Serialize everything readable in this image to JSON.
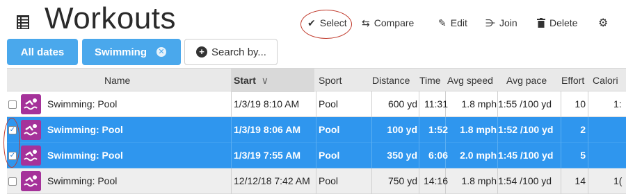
{
  "header": {
    "title": "Workouts",
    "actions": {
      "select": "Select",
      "compare": "Compare",
      "edit": "Edit",
      "join": "Join",
      "delete": "Delete"
    }
  },
  "filters": {
    "all_dates": "All dates",
    "swimming": "Swimming",
    "search_by": "Search by..."
  },
  "table": {
    "headers": {
      "name": "Name",
      "start": "Start",
      "sport": "Sport",
      "distance": "Distance",
      "time": "Time",
      "avg_speed": "Avg speed",
      "avg_pace": "Avg pace",
      "effort": "Effort",
      "calories": "Calori"
    },
    "rows": [
      {
        "name": "Swimming: Pool",
        "start": "1/3/19 8:10 AM",
        "sport": "Pool",
        "distance": "600 yd",
        "time": "11:31",
        "avg_speed": "1.8 mph",
        "avg_pace": "1:55 /100 yd",
        "effort": "10",
        "calories": "1:",
        "checked": false,
        "selected": false
      },
      {
        "name": "Swimming: Pool",
        "start": "1/3/19 8:06 AM",
        "sport": "Pool",
        "distance": "100 yd",
        "time": "1:52",
        "avg_speed": "1.8 mph",
        "avg_pace": "1:52 /100 yd",
        "effort": "2",
        "calories": "",
        "checked": true,
        "selected": true
      },
      {
        "name": "Swimming: Pool",
        "start": "1/3/19 7:55 AM",
        "sport": "Pool",
        "distance": "350 yd",
        "time": "6:06",
        "avg_speed": "2.0 mph",
        "avg_pace": "1:45 /100 yd",
        "effort": "5",
        "calories": "",
        "checked": true,
        "selected": true
      },
      {
        "name": "Swimming: Pool",
        "start": "12/12/18 7:42 AM",
        "sport": "Pool",
        "distance": "750 yd",
        "time": "14:16",
        "avg_speed": "1.8 mph",
        "avg_pace": "1:54 /100 yd",
        "effort": "14",
        "calories": "1(",
        "checked": false,
        "selected": false
      }
    ]
  },
  "colors": {
    "accent": "#4aa8ec",
    "selected_row": "#2f96ee",
    "sport_icon": "#a5329a",
    "annotation": "#c0392b"
  }
}
